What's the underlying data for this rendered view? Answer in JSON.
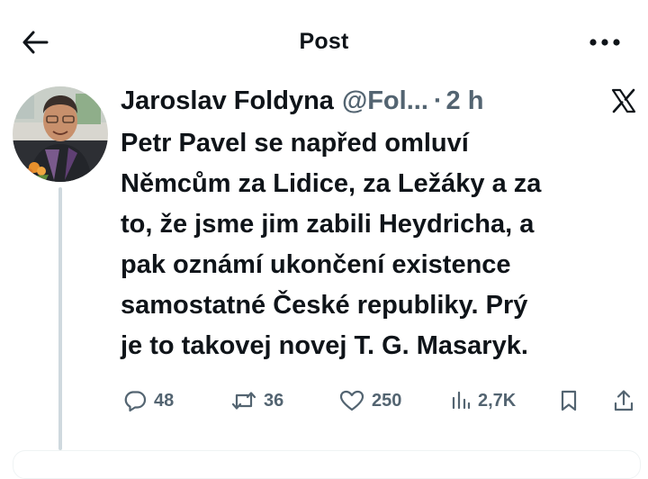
{
  "header": {
    "title": "Post",
    "back_icon": "arrow-left-icon",
    "more_icon": "more-horizontal-icon"
  },
  "tweet": {
    "author": {
      "display_name": "Jaroslav Foldyna",
      "handle": "@Fol...",
      "separator": "·",
      "time": "2 h"
    },
    "text_lines": [
      "Petr Pavel se napřed omluví",
      "Němcům za Lidice, za Ležáky a za",
      "to, že jsme jim zabili Heydricha, a",
      "pak oznámí ukončení existence",
      "samostatné České republiky. Prý",
      "je to takovej novej T. G. Masaryk."
    ],
    "metrics": {
      "replies": "48",
      "reposts": "36",
      "likes": "250",
      "views": "2,7K"
    }
  },
  "colors": {
    "text_primary": "#0f1419",
    "text_secondary": "#536471",
    "thread_line": "#cfd9de"
  }
}
